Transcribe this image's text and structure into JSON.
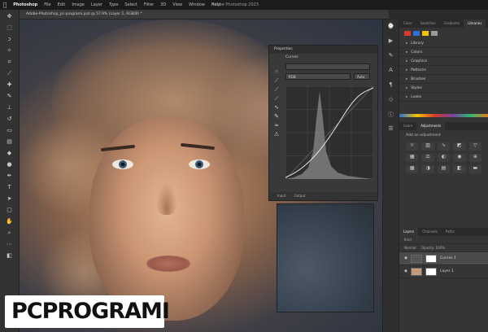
{
  "menubar": {
    "app": "Photoshop",
    "items": [
      "File",
      "Edit",
      "Image",
      "Layer",
      "Type",
      "Select",
      "Filter",
      "3D",
      "View",
      "Window",
      "Help"
    ],
    "window_title": "Adobe Photoshop 2023"
  },
  "document": {
    "tab": "Adobe-Photoshop_pc-programi.psd @ 57.9% (Layer 1, RGB/8) *"
  },
  "tools": [
    "move-icon",
    "marquee-icon",
    "lasso-icon",
    "magic-wand-icon",
    "crop-icon",
    "eyedropper-icon",
    "healing-icon",
    "brush-icon",
    "stamp-icon",
    "history-brush-icon",
    "eraser-icon",
    "gradient-icon",
    "blur-icon",
    "dodge-icon",
    "pen-icon",
    "type-icon",
    "path-select-icon",
    "shape-icon",
    "hand-icon",
    "zoom-icon",
    "more-icon"
  ],
  "properties": {
    "title": "Properties",
    "preset_label": "Curves",
    "channel": "RGB",
    "auto": "Auto",
    "footer_left": "Input",
    "footer_right": "Output"
  },
  "panel_top": {
    "tabs": [
      "Color",
      "Swatches",
      "Gradients",
      "Libraries"
    ],
    "active": "Libraries",
    "swatch_colors": [
      "#d83a2f",
      "#2f6fd8",
      "#f2c400",
      "#9a9a9a"
    ],
    "items": [
      "Library",
      "Colors",
      "Graphics",
      "Patterns",
      "Brushes",
      "Styles",
      "Looks"
    ]
  },
  "panel_adjust": {
    "tabs": [
      "Learn",
      "Adjustments"
    ],
    "active": "Adjustments",
    "subtitle": "Add an adjustment"
  },
  "panel_layers": {
    "tabs": [
      "Layers",
      "Channels",
      "Paths"
    ],
    "active": "Layers",
    "kind": "Kind",
    "blend": "Normal",
    "opacity": "Opacity: 100%",
    "layers": [
      {
        "name": "Curves 1",
        "selected": true
      },
      {
        "name": "Layer 1",
        "selected": false
      }
    ]
  },
  "logo": {
    "text": "PCPROGRAMI"
  }
}
